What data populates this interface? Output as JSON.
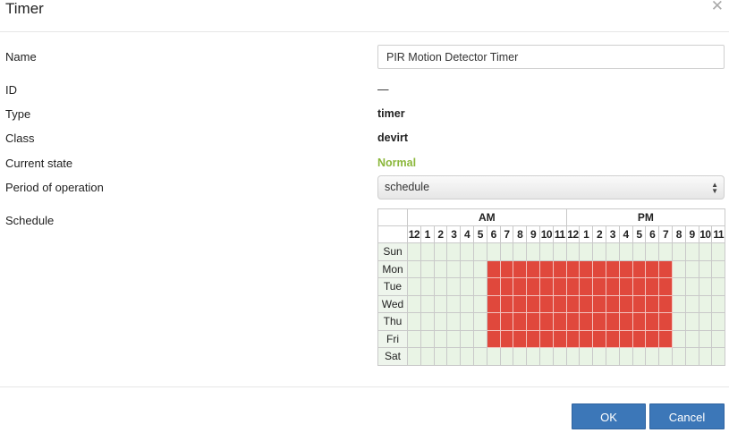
{
  "dialog": {
    "title": "Timer",
    "close_icon": "close-icon"
  },
  "fields": {
    "name": {
      "label": "Name",
      "value": "PIR Motion Detector Timer"
    },
    "id": {
      "label": "ID",
      "value": "—"
    },
    "type": {
      "label": "Type",
      "value": "timer"
    },
    "class": {
      "label": "Class",
      "value": "devirt"
    },
    "current_state": {
      "label": "Current state",
      "value": "Normal",
      "color": "#8bb73b"
    },
    "period": {
      "label": "Period of operation",
      "value": "schedule"
    },
    "schedule": {
      "label": "Schedule"
    }
  },
  "schedule": {
    "am_label": "AM",
    "pm_label": "PM",
    "hours": [
      "12",
      "1",
      "2",
      "3",
      "4",
      "5",
      "6",
      "7",
      "8",
      "9",
      "10",
      "11",
      "12",
      "1",
      "2",
      "3",
      "4",
      "5",
      "6",
      "7",
      "8",
      "9",
      "10",
      "11"
    ],
    "days": [
      "Sun",
      "Mon",
      "Tue",
      "Wed",
      "Thu",
      "Fri",
      "Sat"
    ],
    "active": [
      [
        0,
        0,
        0,
        0,
        0,
        0,
        0,
        0,
        0,
        0,
        0,
        0,
        0,
        0,
        0,
        0,
        0,
        0,
        0,
        0,
        0,
        0,
        0,
        0
      ],
      [
        0,
        0,
        0,
        0,
        0,
        0,
        1,
        1,
        1,
        1,
        1,
        1,
        1,
        1,
        1,
        1,
        1,
        1,
        1,
        1,
        0,
        0,
        0,
        0
      ],
      [
        0,
        0,
        0,
        0,
        0,
        0,
        1,
        1,
        1,
        1,
        1,
        1,
        1,
        1,
        1,
        1,
        1,
        1,
        1,
        1,
        0,
        0,
        0,
        0
      ],
      [
        0,
        0,
        0,
        0,
        0,
        0,
        1,
        1,
        1,
        1,
        1,
        1,
        1,
        1,
        1,
        1,
        1,
        1,
        1,
        1,
        0,
        0,
        0,
        0
      ],
      [
        0,
        0,
        0,
        0,
        0,
        0,
        1,
        1,
        1,
        1,
        1,
        1,
        1,
        1,
        1,
        1,
        1,
        1,
        1,
        1,
        0,
        0,
        0,
        0
      ],
      [
        0,
        0,
        0,
        0,
        0,
        0,
        1,
        1,
        1,
        1,
        1,
        1,
        1,
        1,
        1,
        1,
        1,
        1,
        1,
        1,
        0,
        0,
        0,
        0
      ],
      [
        0,
        0,
        0,
        0,
        0,
        0,
        0,
        0,
        0,
        0,
        0,
        0,
        0,
        0,
        0,
        0,
        0,
        0,
        0,
        0,
        0,
        0,
        0,
        0
      ]
    ],
    "active_color": "#e0483c",
    "inactive_color": "#e9f4e5"
  },
  "buttons": {
    "ok": "OK",
    "cancel": "Cancel",
    "color": "#3c77b8"
  }
}
